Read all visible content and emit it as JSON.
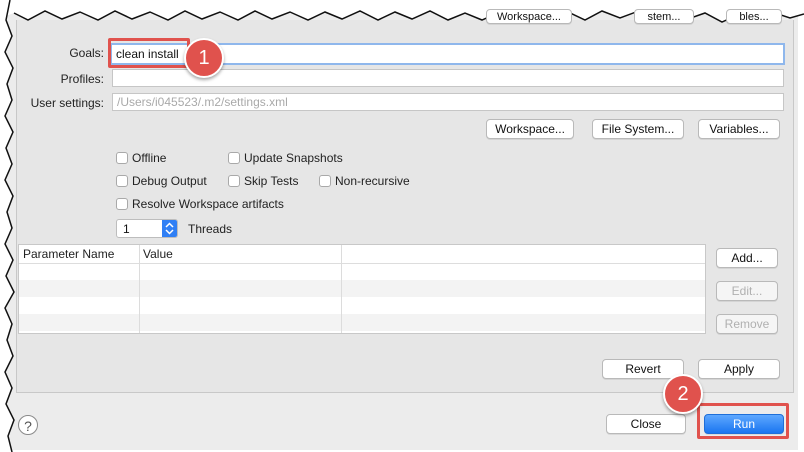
{
  "top_buttons": {
    "workspace": "Workspace...",
    "file_system": "stem...",
    "variables": "bles..."
  },
  "goals": {
    "label": "Goals:",
    "value": "clean install"
  },
  "profiles": {
    "label": "Profiles:",
    "value": ""
  },
  "user_settings": {
    "label": "User settings:",
    "placeholder": "/Users/i045523/.m2/settings.xml"
  },
  "settings_buttons": {
    "workspace": "Workspace...",
    "file_system": "File System...",
    "variables": "Variables..."
  },
  "options": {
    "offline": "Offline",
    "update_snapshots": "Update Snapshots",
    "debug_output": "Debug Output",
    "skip_tests": "Skip Tests",
    "non_recursive": "Non-recursive",
    "resolve_workspace": "Resolve Workspace artifacts"
  },
  "threads": {
    "value": "1",
    "label": "Threads"
  },
  "params_table": {
    "columns": [
      "Parameter Name",
      "Value"
    ],
    "rows": []
  },
  "table_buttons": {
    "add": "Add...",
    "edit": "Edit...",
    "remove": "Remove"
  },
  "actions": {
    "revert": "Revert",
    "apply": "Apply",
    "close": "Close",
    "run": "Run"
  },
  "callouts": {
    "one": "1",
    "two": "2"
  },
  "help": "?",
  "colors": {
    "callout": "#e0524d",
    "primary": "#1a75f0"
  }
}
